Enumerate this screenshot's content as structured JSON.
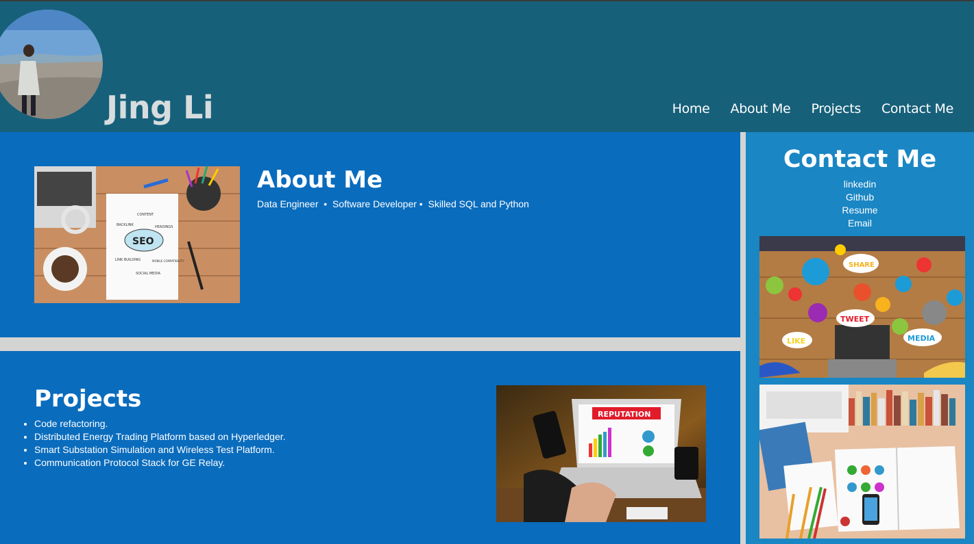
{
  "header": {
    "title": "Jing Li",
    "avatar_icon": "profile-photo",
    "nav": [
      "Home",
      "About Me",
      "Projects",
      "Contact Me"
    ]
  },
  "about": {
    "title": "About Me",
    "tags": "Data Engineer  •  Software Developer •  Skilled SQL and Python",
    "image": {
      "labels": [
        "CONTENT",
        "BACKLINK",
        "HEADINGS",
        "SEO",
        "LINK BUILDING",
        "MOBILE COMPATIBILITY",
        "SOCIAL MEDIA"
      ]
    }
  },
  "projects": {
    "title": "Projects",
    "items": [
      "Code refactoring.",
      "Distributed Energy Trading Platform based on Hyperledger.",
      "Smart Substation Simulation and Wireless Test Platform.",
      "Communication Protocol Stack for GE Relay."
    ],
    "image": {
      "label": "REPUTATION"
    }
  },
  "contact": {
    "title": "Contact Me",
    "links": [
      "linkedin",
      "Github",
      "Resume",
      "Email"
    ],
    "image1": {
      "labels": [
        "SHARE",
        "TWEET",
        "LIKE",
        "MEDIA"
      ]
    }
  },
  "colors": {
    "header_bg": "#17607a",
    "section_bg": "#0a6cbd",
    "contact_bg": "#1a86c4",
    "divider": "#d4d4d2"
  }
}
